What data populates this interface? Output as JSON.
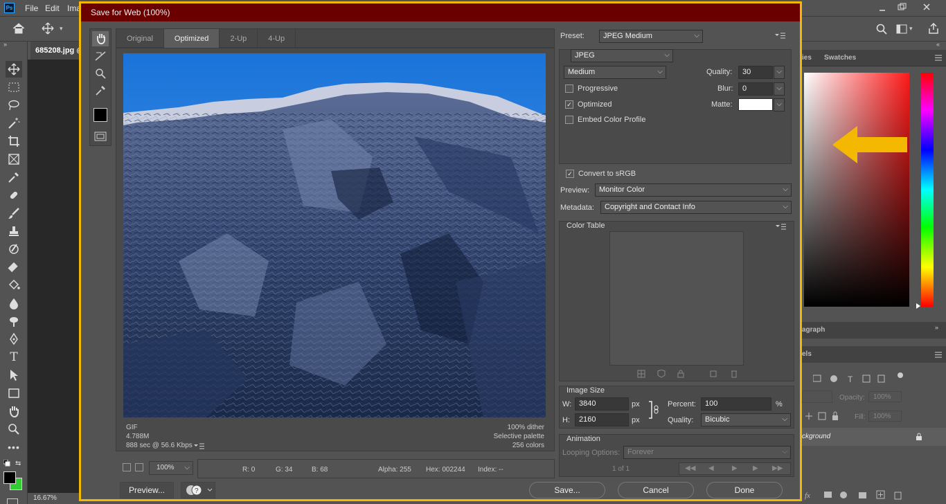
{
  "app": {
    "menu": [
      "File",
      "Edit",
      "Ima"
    ],
    "doc_tab": "685208.jpg @",
    "zoom_status": "16.67%",
    "panel_tabs": [
      "ies",
      "Swatches"
    ],
    "paragraph_tab": "agraph",
    "layers_tab": "els",
    "opacity_label": "Opacity:",
    "opacity_value": "100%",
    "fill_label": "Fill:",
    "fill_value": "100%",
    "layer_name": "ckground"
  },
  "dialog": {
    "title": "Save for Web (100%)",
    "view_tabs": [
      "Original",
      "Optimized",
      "2-Up",
      "4-Up"
    ],
    "active_tab": "Optimized",
    "info_left": [
      "GIF",
      "4.788M",
      "888 sec @ 56.6 Kbps"
    ],
    "info_right": [
      "100% dither",
      "Selective palette",
      "256 colors"
    ],
    "zoom": "100%",
    "pixel_info": {
      "r": "R: 0",
      "g": "G: 34",
      "b": "B: 68",
      "alpha": "Alpha: 255",
      "hex": "Hex: 002244",
      "index": "Index: --"
    },
    "buttons": {
      "preview": "Preview...",
      "save": "Save...",
      "cancel": "Cancel",
      "done": "Done"
    }
  },
  "settings": {
    "preset_label": "Preset:",
    "preset_value": "JPEG Medium",
    "format_value": "JPEG",
    "quality_level": "Medium",
    "quality_label": "Quality:",
    "quality_value": "30",
    "progressive_label": "Progressive",
    "progressive_checked": false,
    "blur_label": "Blur:",
    "blur_value": "0",
    "optimized_label": "Optimized",
    "optimized_checked": true,
    "matte_label": "Matte:",
    "embed_label": "Embed Color Profile",
    "embed_checked": false,
    "srgb_label": "Convert to sRGB",
    "srgb_checked": true,
    "preview_label": "Preview:",
    "preview_value": "Monitor Color",
    "metadata_label": "Metadata:",
    "metadata_value": "Copyright and Contact Info",
    "color_table_label": "Color Table",
    "image_size_label": "Image Size",
    "w_label": "W:",
    "w_value": "3840",
    "h_label": "H:",
    "h_value": "2160",
    "px_unit": "px",
    "percent_label": "Percent:",
    "percent_value": "100",
    "percent_unit": "%",
    "resample_label": "Quality:",
    "resample_value": "Bicubic",
    "animation_label": "Animation",
    "looping_label": "Looping Options:",
    "looping_value": "Forever",
    "frame_counter": "1 of 1"
  },
  "colors": {
    "annotation": "#f5b800",
    "dialog_title_bg": "#6b0000",
    "accent_green": "#33cc33"
  }
}
